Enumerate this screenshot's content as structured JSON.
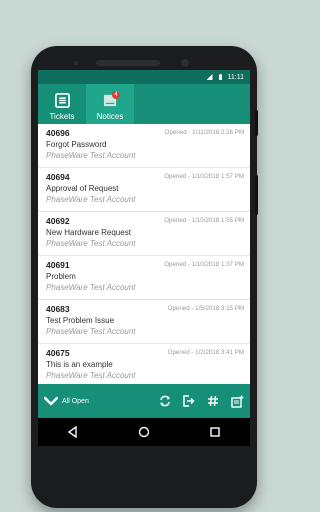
{
  "status_bar": {
    "time": "11:11"
  },
  "tabs": [
    {
      "label": "Tickets",
      "active": false
    },
    {
      "label": "Notices",
      "active": true,
      "badge": "4"
    }
  ],
  "tickets": [
    {
      "number": "40696",
      "subject": "Forgot Password",
      "account": "PhaseWare Test Account",
      "opened": "Opened - 1/11/2018 2:26 PM"
    },
    {
      "number": "40694",
      "subject": "Approval of Request",
      "account": "PhaseWare Test Account",
      "opened": "Opened - 1/10/2018 1:57 PM"
    },
    {
      "number": "40692",
      "subject": "New Hardware Request",
      "account": "PhaseWare Test Account",
      "opened": "Opened - 1/10/2018 1:55 PM"
    },
    {
      "number": "40691",
      "subject": "Problem",
      "account": "PhaseWare Test Account",
      "opened": "Opened - 1/10/2018 1:37 PM"
    },
    {
      "number": "40683",
      "subject": "Test Problem Issue",
      "account": "PhaseWare Test Account",
      "opened": "Opened - 1/5/2018 3:15 PM"
    },
    {
      "number": "40675",
      "subject": "This is an example",
      "account": "PhaseWare Test Account",
      "opened": "Opened - 1/2/2018 3:41 PM"
    }
  ],
  "bottom_bar": {
    "filter_label": "All Open",
    "actions": [
      "refresh-icon",
      "logout-icon",
      "hash-icon",
      "new-ticket-icon"
    ]
  },
  "colors": {
    "primary": "#168f79",
    "primary_dark": "#0f6e5e",
    "accent": "#1fa68c",
    "badge": "#e53935"
  }
}
